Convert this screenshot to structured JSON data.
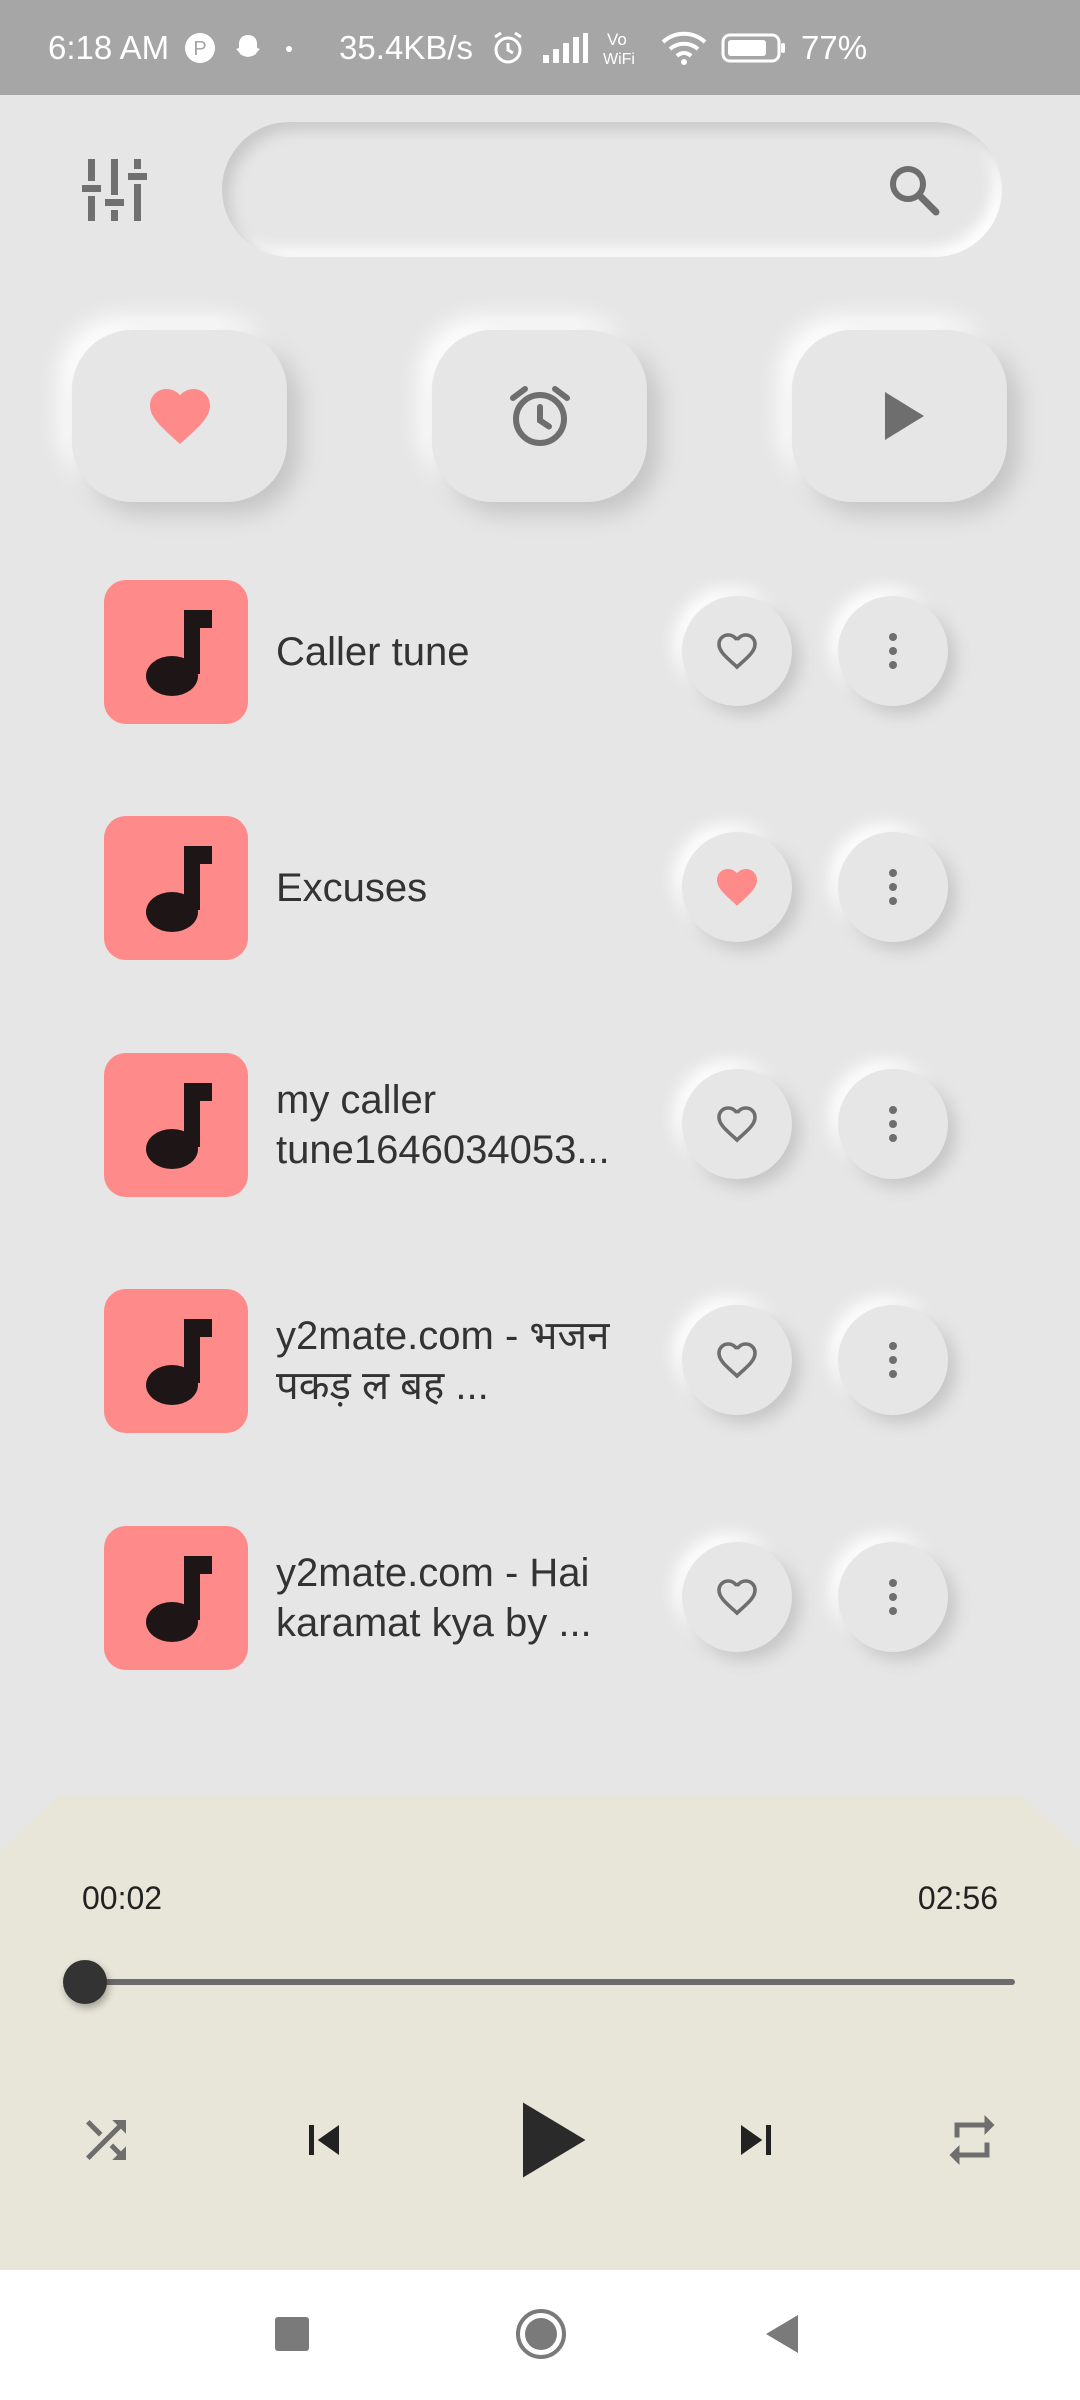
{
  "status_bar": {
    "time": "6:18 AM",
    "speed": "35.4KB/s",
    "battery": "77%",
    "icons": [
      "alarm-icon",
      "signal-icon",
      "vowifi-icon",
      "wifi-icon",
      "battery-icon"
    ]
  },
  "search": {
    "value": "",
    "placeholder": ""
  },
  "quick_buttons": [
    "favorites-heart-icon",
    "alarm-clock-icon",
    "play-icon"
  ],
  "songs": [
    {
      "title": "Caller tune",
      "favorite": false
    },
    {
      "title": "Excuses",
      "favorite": true
    },
    {
      "title": "my caller tune1646034053...",
      "favorite": false
    },
    {
      "title": "y2mate.com - भजन  पकड़ ल बह ...",
      "favorite": false
    },
    {
      "title": "y2mate.com - Hai karamat kya by ...",
      "favorite": false
    }
  ],
  "player": {
    "current_time": "00:02",
    "total_time": "02:56",
    "progress": 0.011
  },
  "colors": {
    "accent": "#ff8a8a",
    "background": "#e6e6e6",
    "player_bg": "#e8e6d8",
    "status_bar": "#a6a6a6"
  }
}
